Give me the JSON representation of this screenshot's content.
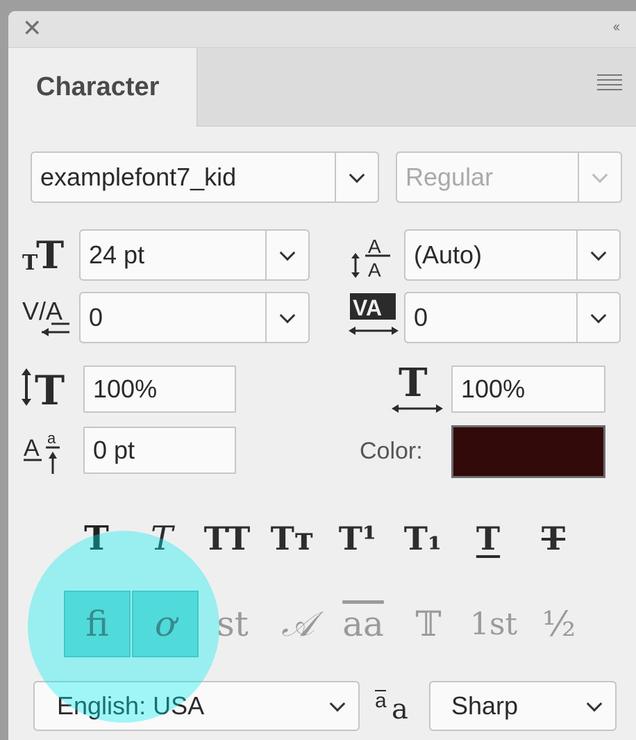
{
  "window": {
    "close_icon": "close-icon",
    "collapse_icon": "double-chevron-left-icon",
    "close_glyph": "✕",
    "collapse_glyph": "‹‹"
  },
  "panel": {
    "tab_title": "Character",
    "menu_icon": "panel-menu-icon"
  },
  "font": {
    "family": "examplefont7_kid",
    "style": "Regular",
    "style_enabled": false
  },
  "size": {
    "value": "24 pt",
    "icon": "font-size-icon"
  },
  "leading": {
    "value": "(Auto)",
    "icon": "leading-icon"
  },
  "kerning": {
    "value": "0",
    "icon": "kerning-icon"
  },
  "tracking": {
    "value": "0",
    "icon": "tracking-icon"
  },
  "vertical_scale": {
    "value": "100%",
    "icon": "vertical-scale-icon"
  },
  "horizontal_scale": {
    "value": "100%",
    "icon": "horizontal-scale-icon"
  },
  "baseline_shift": {
    "value": "0 pt",
    "icon": "baseline-shift-icon"
  },
  "color": {
    "label": "Color:",
    "swatch": "#330a0a"
  },
  "style_buttons": [
    {
      "name": "faux-bold",
      "glyph": "T"
    },
    {
      "name": "faux-italic",
      "glyph": "T"
    },
    {
      "name": "all-caps",
      "glyph": "TT"
    },
    {
      "name": "small-caps",
      "glyph": "Tт"
    },
    {
      "name": "superscript",
      "glyph": "T¹"
    },
    {
      "name": "subscript",
      "glyph": "T₁"
    },
    {
      "name": "underline",
      "glyph": "T"
    },
    {
      "name": "strikethrough",
      "glyph": "T"
    }
  ],
  "opentype_buttons": [
    {
      "name": "standard-ligatures",
      "glyph": "fi",
      "active": true
    },
    {
      "name": "contextual-alternates",
      "glyph": "ơ",
      "active": true
    },
    {
      "name": "discretionary-ligatures",
      "glyph": "st",
      "active": false
    },
    {
      "name": "swash",
      "glyph": "𝒜",
      "active": false
    },
    {
      "name": "stylistic-alternates",
      "glyph": "aa",
      "active": false
    },
    {
      "name": "titling-alternates",
      "glyph": "𝕋",
      "active": false
    },
    {
      "name": "ordinals",
      "glyph": "1st",
      "active": false
    },
    {
      "name": "fractions",
      "glyph": "½",
      "active": false
    }
  ],
  "language": {
    "value": "English: USA"
  },
  "antialias": {
    "value": "Sharp",
    "icon": "antialias-icon"
  },
  "highlight_color": "#00ebf0"
}
